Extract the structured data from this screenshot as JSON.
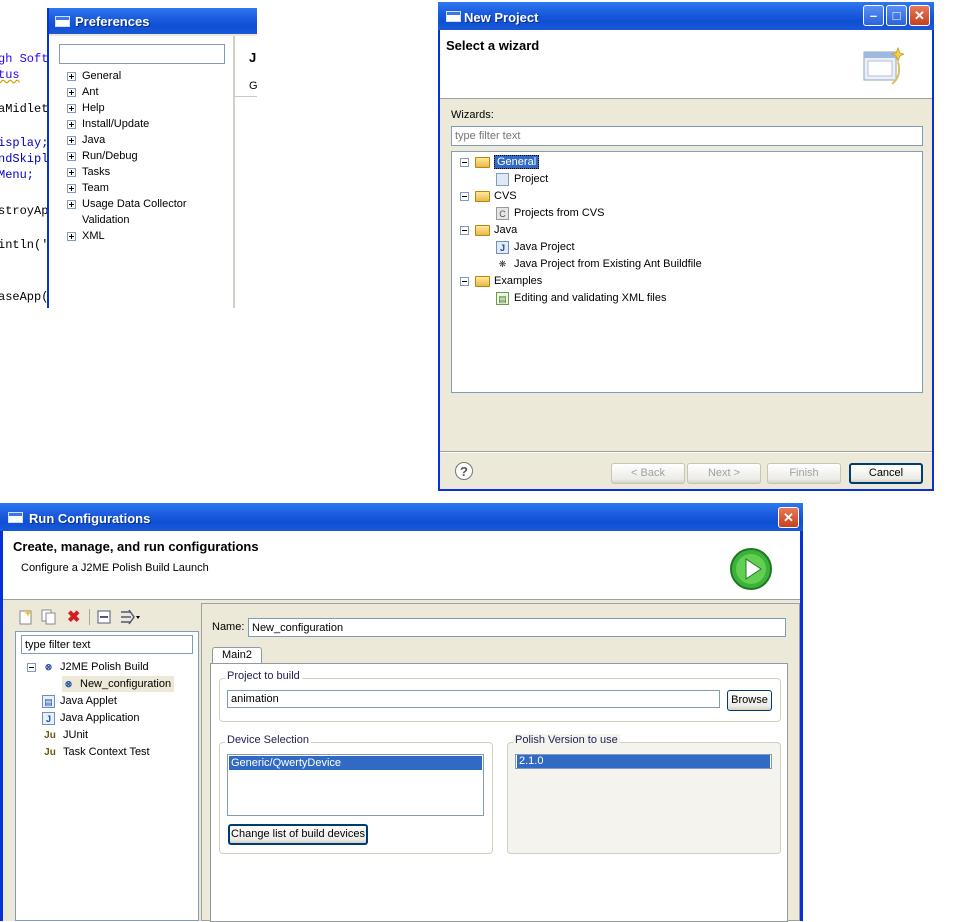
{
  "code_fragment": {
    "lines": [
      "gh Soft",
      "tus",
      "aMidlet",
      "isplay;",
      "ndSkipl",
      "Menu;",
      "stroyAp",
      "intln('",
      "aseApp("
    ]
  },
  "preferences": {
    "title": "Preferences",
    "filter_value": "",
    "tree": [
      "General",
      "Ant",
      "Help",
      "Install/Update",
      "Java",
      "Run/Debug",
      "Tasks",
      "Team",
      "Usage Data Collector",
      "Validation",
      "XML"
    ],
    "right_heading": "J",
    "right_sub": "G"
  },
  "new_project": {
    "title": "New Project",
    "heading": "Select a wizard",
    "wizards_label": "Wizards:",
    "filter_placeholder": "type filter text",
    "tree": [
      {
        "label": "General",
        "level": 0
      },
      {
        "label": "Project",
        "level": 1
      },
      {
        "label": "CVS",
        "level": 0
      },
      {
        "label": "Projects from CVS",
        "level": 1
      },
      {
        "label": "Java",
        "level": 0
      },
      {
        "label": "Java Project",
        "level": 1
      },
      {
        "label": "Java Project from Existing Ant Buildfile",
        "level": 1
      },
      {
        "label": "Examples",
        "level": 0
      },
      {
        "label": "Editing and validating XML files",
        "level": 1
      }
    ],
    "buttons": {
      "back": "< Back",
      "next": "Next >",
      "finish": "Finish",
      "cancel": "Cancel"
    },
    "help_glyph": "?"
  },
  "run_configs": {
    "title": "Run Configurations",
    "heading": "Create, manage, and run configurations",
    "subheading": "Configure a J2ME Polish Build Launch",
    "filter_value": "type filter text",
    "tree": [
      {
        "label": "J2ME Polish Build",
        "level": 0
      },
      {
        "label": "New_configuration",
        "level": 1
      },
      {
        "label": "Java Applet",
        "level": 0
      },
      {
        "label": "Java Application",
        "level": 0
      },
      {
        "label": "JUnit",
        "level": 0
      },
      {
        "label": "Task Context Test",
        "level": 0
      }
    ],
    "name_label": "Name:",
    "name_value": "New_configuration",
    "tab_label": "Main2",
    "project_group": "Project to build",
    "project_value": "animation",
    "browse_label": "Browse",
    "device_group": "Device Selection",
    "device_items": [
      "Generic/QwertyDevice"
    ],
    "change_devices_label": "Change list of build devices",
    "polish_group": "Polish Version to use",
    "polish_items": [
      "2.1.0"
    ]
  },
  "colors": {
    "title_blue": "#0f4fd4",
    "selection": "#316ac5",
    "dialog_bg": "#ece9d8"
  }
}
